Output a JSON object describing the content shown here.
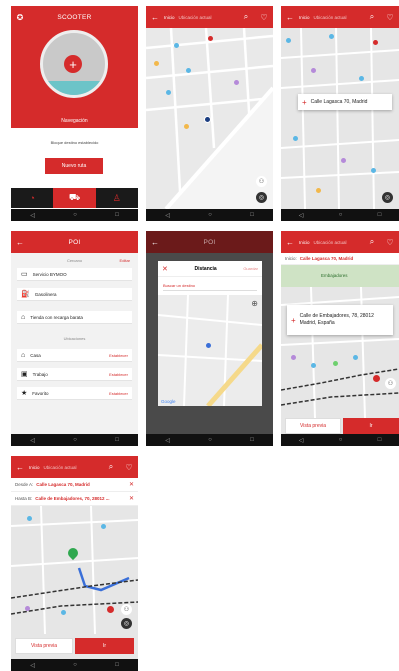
{
  "screen1": {
    "title": "SCOOTER",
    "status_label": "Navegación",
    "status_sub": "Bloque destino establecido",
    "new_route": "Nuevo ruta"
  },
  "screen2": {
    "from": "Inicio",
    "to": "Ubicación actual"
  },
  "screen3": {
    "from": "Inicio",
    "to": "Ubicación actual",
    "card": "Calle Lagasca 70, Madrid"
  },
  "screen4": {
    "title": "POI",
    "section1": "Cercano",
    "section1_action": "Editar",
    "items1": [
      "Servicio BYMOO",
      "Gasolinera",
      "Tienda con recarga barata"
    ],
    "section2": "Ubicaciones",
    "items2": [
      {
        "label": "Casa",
        "action": "Establecer"
      },
      {
        "label": "Trabajo",
        "action": "Establecer"
      },
      {
        "label": "Favorito",
        "action": "Establecer"
      }
    ]
  },
  "screen5": {
    "title": "POI",
    "dialog_title": "Distancia",
    "dialog_action": "Guardar",
    "input": "Buscar un destino",
    "logo": "Google"
  },
  "screen6": {
    "from": "Inicio",
    "to": "Ubicación actual",
    "field_label": "Inicio:",
    "field_value": "Calle Lagasca 70, Madrid",
    "map_label": "Embajadores",
    "card": "Calle de Embajadores, 78, 28012 Madrid, España",
    "preview": "Vista previa",
    "go": "Ir"
  },
  "screen7": {
    "from": "Inicio",
    "to": "Ubicación actual",
    "f1_label": "Desde A:",
    "f1_value": "Calle Lagasca 70, Madrid",
    "f2_label": "Hasta B:",
    "f2_value": "Calle de Embajadores, 70, 28012 ...",
    "preview": "Vista previa",
    "go": "Ir"
  },
  "colors": {
    "accent": "#d52b2b",
    "nav": "#111111",
    "map": "#e8e8e8"
  }
}
